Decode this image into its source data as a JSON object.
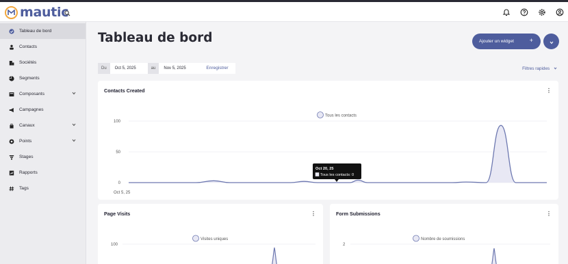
{
  "app": {
    "name": "mautic"
  },
  "header": {
    "icons": [
      "notifications-icon",
      "help-icon",
      "settings-icon",
      "user-icon"
    ]
  },
  "sidebar": {
    "items": [
      {
        "label": "Tableau de bord",
        "icon": "dashboard-icon",
        "active": true
      },
      {
        "label": "Contacts",
        "icon": "person-icon"
      },
      {
        "label": "Sociétés",
        "icon": "building-icon"
      },
      {
        "label": "Segments",
        "icon": "pie-icon"
      },
      {
        "label": "Composants",
        "icon": "component-icon",
        "has_children": true
      },
      {
        "label": "Campagnes",
        "icon": "megaphone-icon"
      },
      {
        "label": "Canaux",
        "icon": "channel-icon",
        "has_children": true
      },
      {
        "label": "Points",
        "icon": "points-icon",
        "has_children": true
      },
      {
        "label": "Stages",
        "icon": "stages-icon"
      },
      {
        "label": "Rapports",
        "icon": "report-icon"
      },
      {
        "label": "Tags",
        "icon": "tag-icon"
      }
    ]
  },
  "main": {
    "title": "Tableau de bord",
    "add_widget_label": "Ajouter un widget",
    "add_widget_plus": "+",
    "date_from_label": "Du",
    "date_from": "Oct 5, 2025",
    "date_to_label": "au",
    "date_to": "Nov 5, 2025",
    "save_label": "Enregistrer",
    "quick_filters_label": "Filtres rapides"
  },
  "widgets": {
    "contacts": {
      "title": "Contacts Created",
      "tooltip_title": "Oct 20, 25",
      "tooltip_value": "Tous les contacts: 0"
    },
    "page_visits": {
      "title": "Page Visits"
    },
    "forms": {
      "title": "Form Submissions"
    }
  },
  "colors": {
    "accent": "#4e5d9d",
    "brand_orange": "#f1a73e",
    "series_fill": "#e8e8f4"
  },
  "chart_data": [
    {
      "type": "area",
      "title": "Contacts Created",
      "legend": "Tous les contacts",
      "x_first_label": "Oct 5, 25",
      "y_ticks": [
        "0",
        "50",
        "100"
      ],
      "ylim": [
        0,
        100
      ],
      "x_start": "2025-10-05",
      "x_end": "2025-11-05",
      "series": [
        {
          "name": "Tous les contacts",
          "points": [
            [
              0,
              0
            ],
            [
              5,
              0
            ],
            [
              6.3,
              3
            ],
            [
              7.5,
              0
            ],
            [
              12,
              0
            ],
            [
              13,
              2
            ],
            [
              14,
              0
            ],
            [
              16.4,
              0
            ],
            [
              17,
              4
            ],
            [
              17.7,
              0
            ],
            [
              24,
              0
            ],
            [
              25,
              1
            ],
            [
              26.5,
              0
            ],
            [
              27.6,
              93
            ],
            [
              28.7,
              0
            ],
            [
              31,
              0
            ]
          ]
        }
      ]
    },
    {
      "type": "area",
      "title": "Page Visits",
      "legend": "Visites uniques",
      "y_ticks": [
        "100"
      ],
      "series": [
        {
          "name": "Visites uniques",
          "peak_fraction": 0.86
        }
      ]
    },
    {
      "type": "area",
      "title": "Form Submissions",
      "legend": "Nombre de soumissions",
      "y_ticks": [
        "2"
      ],
      "series": [
        {
          "name": "Nombre de soumissions",
          "peak_fraction": 0.87
        }
      ]
    }
  ]
}
